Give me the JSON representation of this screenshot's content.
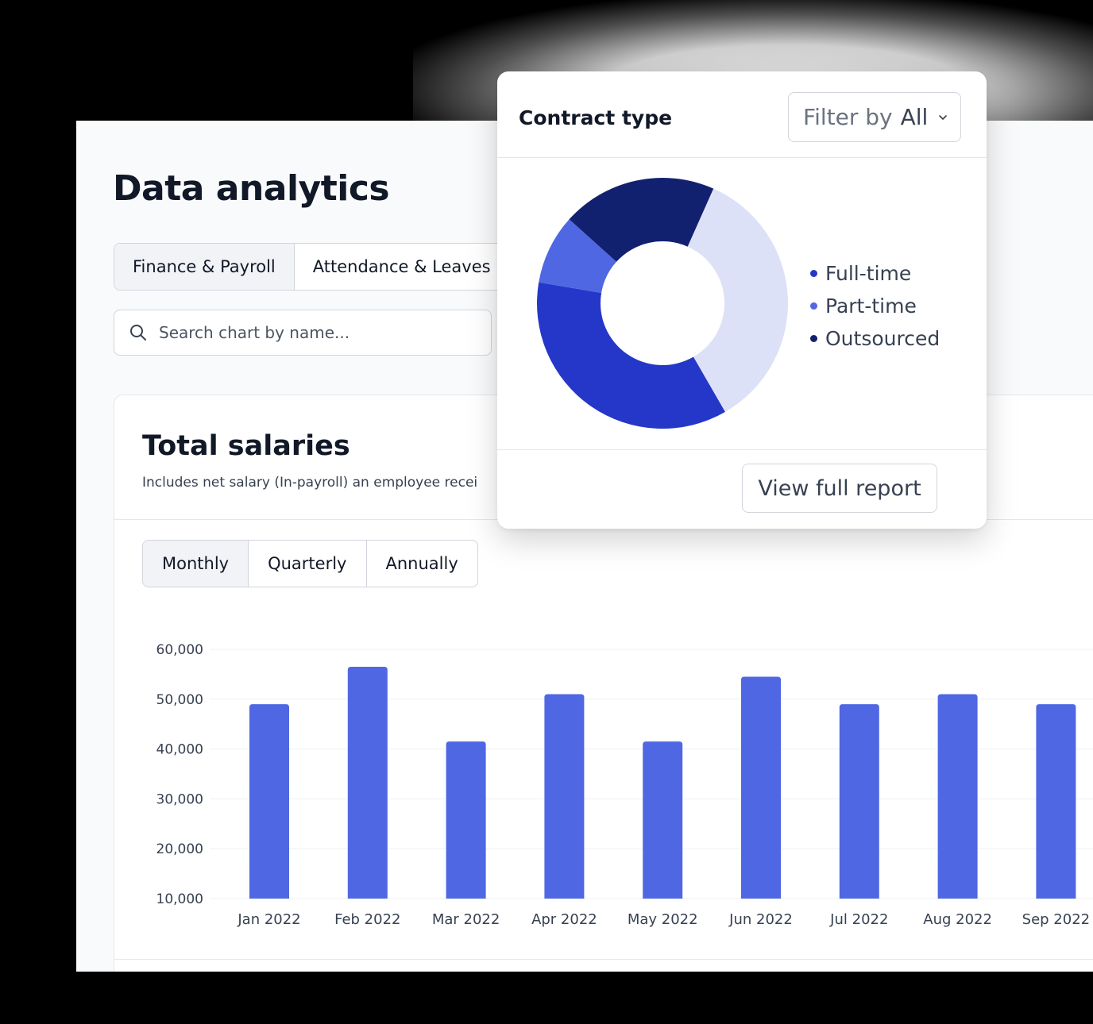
{
  "page": {
    "title": "Data analytics"
  },
  "tabs": [
    {
      "label": "Finance & Payroll",
      "active": true
    },
    {
      "label": "Attendance & Leaves",
      "active": false
    }
  ],
  "search": {
    "placeholder": "Search chart by name...",
    "value": ""
  },
  "salaries_card": {
    "title": "Total salaries",
    "subtitle": "Includes net salary (In-payroll) an employee recei",
    "periods": [
      {
        "label": "Monthly",
        "active": true
      },
      {
        "label": "Quarterly",
        "active": false
      },
      {
        "label": "Annually",
        "active": false
      }
    ]
  },
  "contract_popup": {
    "title": "Contract type",
    "filter_label": "Filter by",
    "filter_value": "All",
    "button_label": "View full report"
  },
  "colors": {
    "bar": "#4f67e3",
    "full_time": "#2537c8",
    "part_time": "#4f67e3",
    "outsourced": "#12216f",
    "other": "#dde1f7"
  },
  "chart_data": [
    {
      "type": "bar",
      "title": "Total salaries",
      "categories": [
        "Jan 2022",
        "Feb 2022",
        "Mar 2022",
        "Apr 2022",
        "May 2022",
        "Jun 2022",
        "Jul 2022",
        "Aug 2022",
        "Sep 2022"
      ],
      "values": [
        49000,
        56500,
        41500,
        51000,
        41500,
        54500,
        49000,
        51000,
        49000
      ],
      "y_ticks": [
        "60,000",
        "50,000",
        "40,000",
        "30,000",
        "20,000",
        "10,000"
      ],
      "ylim": [
        10000,
        60000
      ],
      "grid": true
    },
    {
      "type": "pie",
      "title": "Contract type",
      "legend": [
        "Full-time",
        "Part-time",
        "Outsourced"
      ],
      "legend_placement": "right",
      "slices": [
        {
          "label": "Full-time",
          "value": 36,
          "color": "#2537c8"
        },
        {
          "label": "Part-time",
          "value": 9,
          "color": "#4f67e3"
        },
        {
          "label": "Outsourced",
          "value": 20,
          "color": "#12216f"
        },
        {
          "label": "",
          "value": 35,
          "color": "#dde1f7"
        }
      ]
    }
  ]
}
